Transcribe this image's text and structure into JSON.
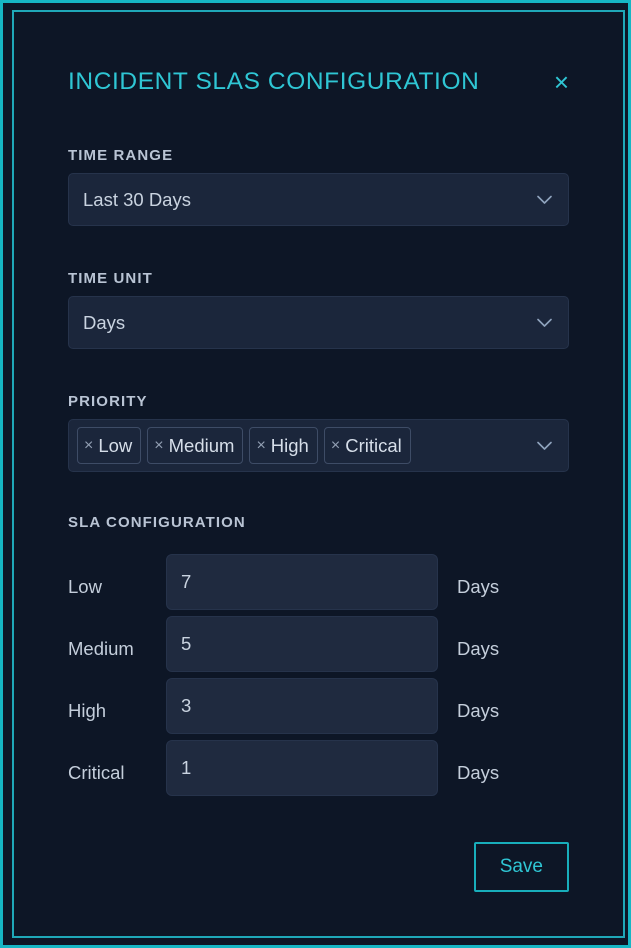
{
  "modal": {
    "title": "INCIDENT SLAS CONFIGURATION",
    "close_label": "×",
    "close_icon": "close-icon"
  },
  "time_range": {
    "label": "TIME RANGE",
    "value": "Last 30 Days",
    "chevron_icon": "chevron-down-icon"
  },
  "time_unit": {
    "label": "TIME UNIT",
    "value": "Days",
    "chevron_icon": "chevron-down-icon"
  },
  "priority": {
    "label": "PRIORITY",
    "chevron_icon": "chevron-down-icon",
    "remove_glyph": "×",
    "tags": [
      {
        "label": "Low"
      },
      {
        "label": "Medium"
      },
      {
        "label": "High"
      },
      {
        "label": "Critical"
      }
    ]
  },
  "sla_configuration": {
    "heading": "SLA CONFIGURATION",
    "rows": [
      {
        "name": "Low",
        "value": "7",
        "unit": "Days"
      },
      {
        "name": "Medium",
        "value": "5",
        "unit": "Days"
      },
      {
        "name": "High",
        "value": "3",
        "unit": "Days"
      },
      {
        "name": "Critical",
        "value": "1",
        "unit": "Days"
      }
    ]
  },
  "footer": {
    "save_label": "Save"
  },
  "colors": {
    "accent": "#2fc6d4",
    "panel_border": "#1fa8b8",
    "background": "#0d1626",
    "input_background": "#1f2a3f",
    "label_text": "#b9c4d4"
  }
}
